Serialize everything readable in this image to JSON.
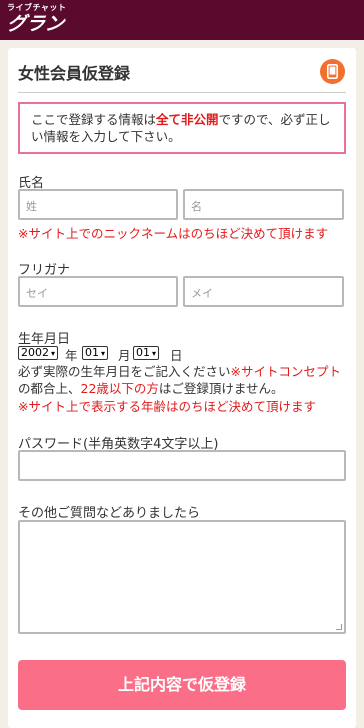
{
  "header": {
    "logo_sub": "ライブチャット",
    "logo_main": "グラン"
  },
  "card": {
    "title": "女性会員仮登録",
    "icon": "smartphone-icon"
  },
  "notice": {
    "part1": "ここで登録する情報は",
    "highlight": "全て非公開",
    "part2": "ですので、必ず正しい情報を入力して下さい。"
  },
  "name": {
    "label": "氏名",
    "last_placeholder": "姓",
    "first_placeholder": "名",
    "note": "※サイト上でのニックネームはのちほど決めて頂けます"
  },
  "kana": {
    "label": "フリガナ",
    "last_placeholder": "セイ",
    "first_placeholder": "メイ"
  },
  "birthday": {
    "label": "生年月日",
    "year": "2002",
    "year_unit": "年",
    "month": "01",
    "month_unit": "月",
    "day": "01",
    "day_unit": "日",
    "note1": "必ず実際の生年月日をご記入ください",
    "note1_mark": "※サイトコンセプト",
    "note2a": "の都合上、",
    "note2_red": "22歳以下の方",
    "note2b": "はご登録頂けません。",
    "note3": "※サイト上で表示する年齢はのちほど決めて頂けます"
  },
  "password": {
    "label": "パスワード(半角英数字4文字以上)",
    "value": ""
  },
  "questions": {
    "label": "その他ご質問などありましたら",
    "value": ""
  },
  "submit_label": "上記内容で仮登録",
  "colors": {
    "header": "#5a0a2c",
    "accent": "#fa6f87",
    "notice_border": "#e7739b",
    "warning": "#e21b1b",
    "icon": "#f07030"
  }
}
